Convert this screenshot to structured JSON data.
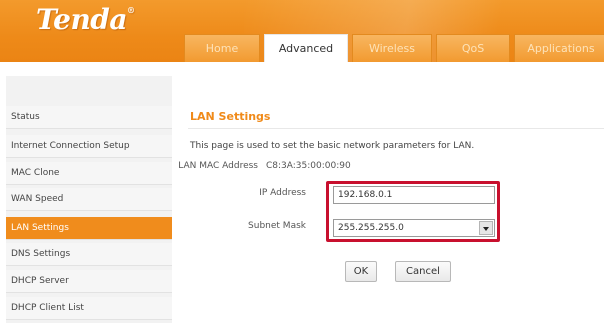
{
  "brand": {
    "logo_text": "Tenda",
    "trademark": "®",
    "header_color": "#EE8A19"
  },
  "nav": {
    "tabs": [
      {
        "label": "Home",
        "active": false
      },
      {
        "label": "Advanced",
        "active": true
      },
      {
        "label": "Wireless",
        "active": false
      },
      {
        "label": "QoS",
        "active": false
      },
      {
        "label": "Applications",
        "active": false
      }
    ]
  },
  "sidebar": {
    "items": [
      {
        "label": "Status",
        "active": false
      },
      {
        "label": "Internet Connection Setup",
        "active": false
      },
      {
        "label": "MAC Clone",
        "active": false
      },
      {
        "label": "WAN Speed",
        "active": false
      },
      {
        "label": "LAN Settings",
        "active": true
      },
      {
        "label": "DNS Settings",
        "active": false
      },
      {
        "label": "DHCP Server",
        "active": false
      },
      {
        "label": "DHCP Client List",
        "active": false
      }
    ]
  },
  "main": {
    "title": "LAN Settings",
    "description": "This page is used to set the basic network parameters for LAN.",
    "mac": {
      "label": "LAN MAC Address",
      "value": "C8:3A:35:00:00:90"
    },
    "ip": {
      "label": "IP Address",
      "value": "192.168.0.1"
    },
    "mask": {
      "label": "Subnet Mask",
      "value": "255.255.255.0"
    },
    "highlight_color": "#C8102E",
    "ok_label": "OK",
    "cancel_label": "Cancel"
  }
}
